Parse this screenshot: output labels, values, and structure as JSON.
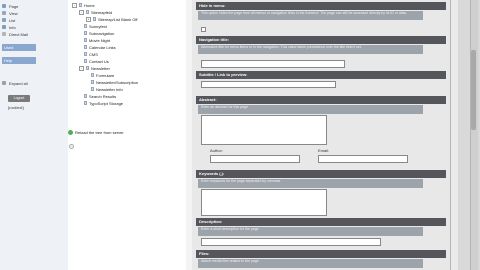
{
  "left_nav": {
    "items": [
      {
        "label": "Page",
        "color": "#7f9dbf"
      },
      {
        "label": "View",
        "color": "#9aa7b6"
      },
      {
        "label": "List",
        "color": "#8fa0b4"
      },
      {
        "label": "Info",
        "color": "#7f9dbf"
      },
      {
        "label": "Direct Mail",
        "color": "#b5b5b5"
      }
    ],
    "section_label": "Used",
    "help_label": "Help",
    "expand_label": "Expand all",
    "button1": "Logout",
    "button2": "[root/ext]"
  },
  "tree": {
    "items": [
      {
        "label": "Home",
        "expander": "-",
        "depth": 0
      },
      {
        "label": "Sitemapfeld",
        "expander": "-",
        "depth": 1
      },
      {
        "label": "Sitemap/List Blank Off",
        "expander": "+",
        "depth": 2
      },
      {
        "label": "Sonnyfeld",
        "expander": "",
        "depth": 1
      },
      {
        "label": "Subnavigation",
        "expander": "",
        "depth": 1
      },
      {
        "label": "Movie Night",
        "expander": "",
        "depth": 1
      },
      {
        "label": "Calendar Links",
        "expander": "",
        "depth": 1
      },
      {
        "label": "CMS",
        "expander": "",
        "depth": 1
      },
      {
        "label": "Contact Us",
        "expander": "",
        "depth": 1
      },
      {
        "label": "Newsletter",
        "expander": "-",
        "depth": 1
      },
      {
        "label": "Formulare",
        "expander": "",
        "depth": 2
      },
      {
        "label": "Newsletter/Subscription",
        "expander": "",
        "depth": 2
      },
      {
        "label": "Newsletter Info",
        "expander": "",
        "depth": 2
      },
      {
        "label": "Search Results",
        "expander": "",
        "depth": 1
      },
      {
        "label": "TypoScript Storage",
        "expander": "",
        "depth": 1
      }
    ],
    "reload_label": "Reload the tree from server"
  },
  "form": {
    "sections": [
      {
        "title": "Hide in menu:",
        "desc": "This option hides the page from all menus or navigation links in the frontend. The page can still be accessed directly by its ID or alias."
      },
      {
        "title": "Navigation title:",
        "desc": "Alternative title for menu items or in the navigation. This value takes precedence over the title field if set."
      },
      {
        "title": "Subtitle / Link to preview:",
        "desc": ""
      },
      {
        "title": "Abstract:",
        "desc": "Enter an abstract for this page"
      },
      {
        "title": "Keywords (,):",
        "desc": "Enter keywords for the page separated by commas."
      },
      {
        "title": "Description:",
        "desc": "Enter a short description for the page"
      },
      {
        "title": "Files:",
        "desc": "Attach media files related to the page"
      }
    ],
    "author_label": "Author:",
    "email_label": "Email:"
  }
}
